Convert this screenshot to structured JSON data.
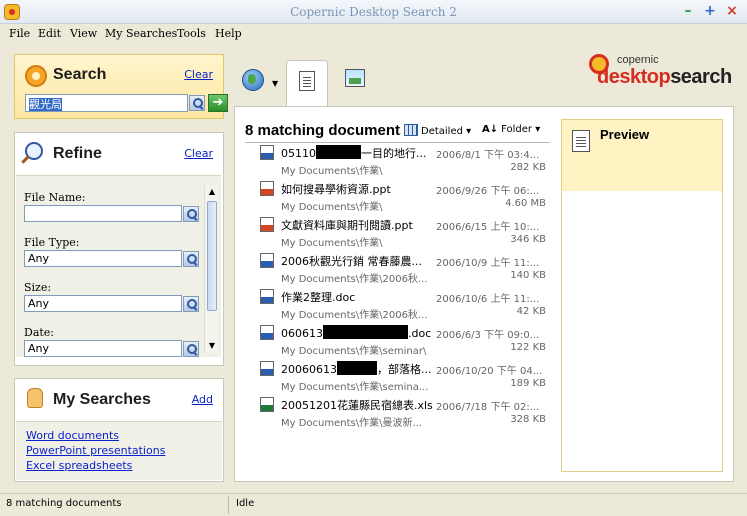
{
  "window": {
    "title": "Copernic Desktop Search 2"
  },
  "menu": {
    "items": [
      {
        "label": "File"
      },
      {
        "label": "Edit"
      },
      {
        "label": "View"
      },
      {
        "label": "My Searches"
      },
      {
        "label": "Tools"
      },
      {
        "label": "Help"
      }
    ]
  },
  "search": {
    "title": "Search",
    "clear_label": "Clear",
    "query": "觀光局"
  },
  "refine": {
    "title": "Refine",
    "clear_label": "Clear",
    "fields": [
      {
        "label": "File Name:",
        "value": ""
      },
      {
        "label": "File Type:",
        "value": "Any"
      },
      {
        "label": "Size:",
        "value": "Any"
      },
      {
        "label": "Date:",
        "value": "Any"
      }
    ]
  },
  "my_searches": {
    "title": "My Searches",
    "add_label": "Add",
    "items": [
      {
        "label": "Word documents"
      },
      {
        "label": "PowerPoint presentations"
      },
      {
        "label": "Excel spreadsheets"
      }
    ]
  },
  "logo": {
    "small": "copernic",
    "desktop": "desktop",
    "search": "search"
  },
  "results": {
    "count_label": "8 matching documents",
    "view_label": "Detailed",
    "sort_label": "Folder",
    "items": [
      {
        "type": "doc",
        "name_pre": "05110",
        "name_post": "一目的地行...",
        "date": "2006/8/1 下午 03:4...",
        "path": "My Documents\\作業\\",
        "size": "282 KB"
      },
      {
        "type": "ppt",
        "name_pre": "如何搜尋學術資源.ppt",
        "name_post": "",
        "date": "2006/9/26 下午 06:...",
        "path": "My Documents\\作業\\",
        "size": "4.60 MB"
      },
      {
        "type": "ppt",
        "name_pre": "文獻資料庫與期刊閱讀.ppt",
        "name_post": "",
        "date": "2006/6/15 上午 10:...",
        "path": "My Documents\\作業\\",
        "size": "346 KB"
      },
      {
        "type": "doc",
        "name_pre": "2006秋觀光行銷 常春藤農...",
        "name_post": "",
        "date": "2006/10/9 上午 11:...",
        "path": "My Documents\\作業\\2006秋...",
        "size": "140 KB"
      },
      {
        "type": "doc",
        "name_pre": "作業2整理.doc",
        "name_post": "",
        "date": "2006/10/6 上午 11:...",
        "path": "My Documents\\作業\\2006秋...",
        "size": "42 KB"
      },
      {
        "type": "doc",
        "name_pre": "060613",
        "name_post": ".doc",
        "date": "2006/6/3 下午 09:0...",
        "path": "My Documents\\作業\\seminar\\",
        "size": "122 KB"
      },
      {
        "type": "doc",
        "name_pre": "20060613",
        "name_post": "，部落格...",
        "date": "2006/10/20 下午 04...",
        "path": "My Documents\\作業\\semina...",
        "size": "189 KB"
      },
      {
        "type": "xls",
        "name_pre": "20051201花蓮縣民宿總表.xls",
        "name_post": "",
        "date": "2006/7/18 下午 02:...",
        "path": "My Documents\\作業\\曼波新...",
        "size": "328 KB"
      }
    ]
  },
  "preview": {
    "title": "Preview"
  },
  "status": {
    "left": "8 matching documents",
    "right": "Idle"
  }
}
